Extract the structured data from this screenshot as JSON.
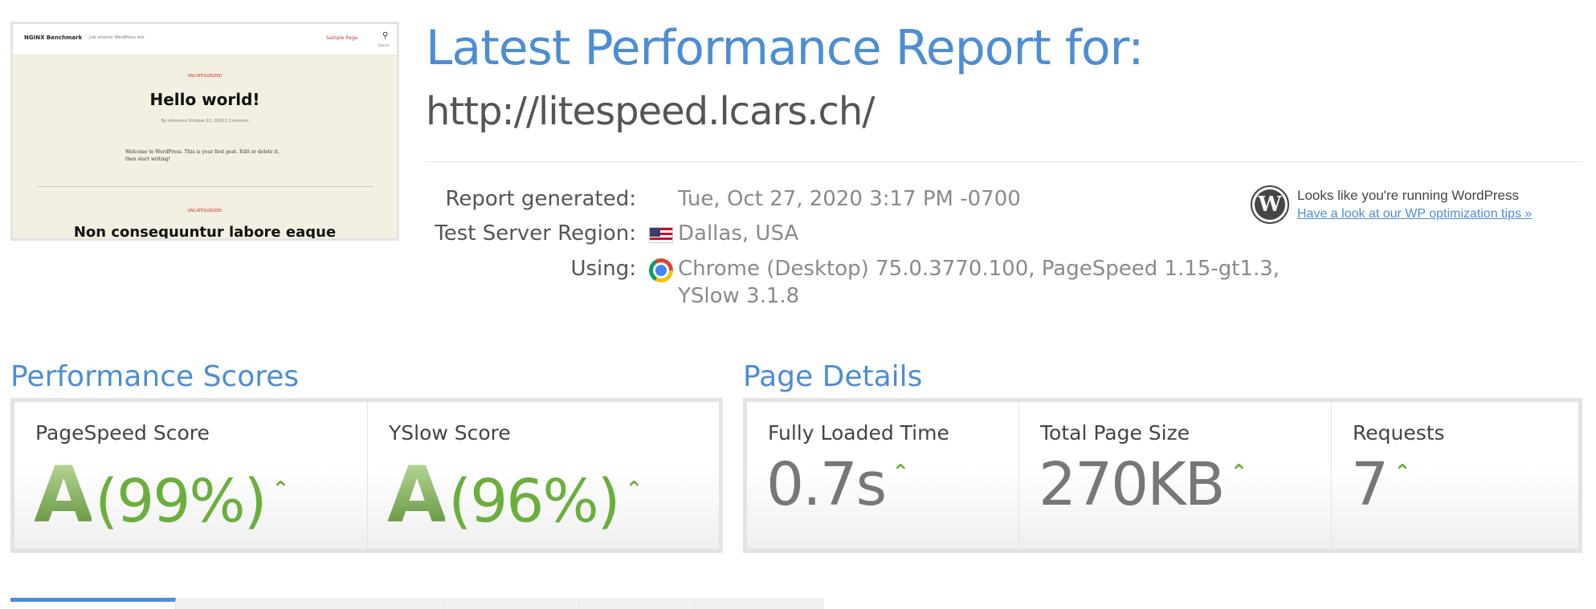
{
  "thumbnail": {
    "site_name": "NGINX Benchmark",
    "tagline": "Just another WordPress site",
    "nav_link": "Sample Page",
    "search_label": "Search",
    "category": "UNCATEGORIZED",
    "post1_title": "Hello world!",
    "post1_meta": "By mhomanz   October 22, 2020   1 Comment",
    "post1_body": "Welcome to WordPress. This is your first post. Edit or delete it, then start writing!",
    "post2_title": "Non consequuntur labore eaque"
  },
  "header": {
    "title": "Latest Performance Report for:",
    "url": "http://litespeed.lcars.ch/"
  },
  "info": {
    "generated_label": "Report generated:",
    "generated_value": "Tue, Oct 27, 2020 3:17 PM -0700",
    "region_label": "Test Server Region:",
    "region_value": "Dallas, USA",
    "using_label": "Using:",
    "using_value_line1": "Chrome (Desktop) 75.0.3770.100, PageSpeed 1.15-gt1.3,",
    "using_value_line2": "YSlow 3.1.8"
  },
  "wordpress": {
    "text": "Looks like you're running WordPress",
    "link": "Have a look at our WP optimization tips »"
  },
  "performance": {
    "title": "Performance Scores",
    "pagespeed_label": "PageSpeed Score",
    "pagespeed_grade": "A",
    "pagespeed_pct": "(99%)",
    "yslow_label": "YSlow Score",
    "yslow_grade": "A",
    "yslow_pct": "(96%)"
  },
  "details": {
    "title": "Page Details",
    "load_label": "Fully Loaded Time",
    "load_value": "0.7s",
    "size_label": "Total Page Size",
    "size_value": "270KB",
    "requests_label": "Requests",
    "requests_value": "7"
  },
  "icons": {
    "trend": "chevron-up-icon",
    "wordpress": "wordpress-logo-icon",
    "flag": "us-flag-icon",
    "browser": "chrome-icon"
  },
  "colors": {
    "accent": "#4d8dd3",
    "good": "#6aaf3d",
    "text": "#555555"
  }
}
